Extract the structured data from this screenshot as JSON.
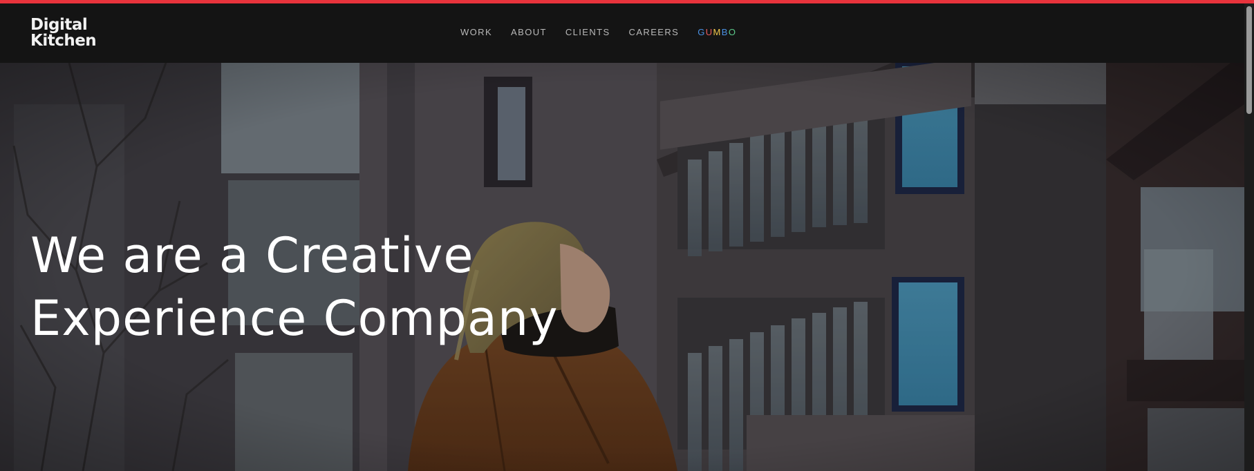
{
  "brand": {
    "logo_line1": "Digital",
    "logo_line2": "Kitchen",
    "accent_color": "#e8333c"
  },
  "nav": {
    "items": [
      {
        "label": "WORK"
      },
      {
        "label": "ABOUT"
      },
      {
        "label": "CLIENTS"
      },
      {
        "label": "CAREERS"
      }
    ],
    "gumbo": {
      "letters": [
        {
          "char": "G",
          "color": "#4a90e2"
        },
        {
          "char": "U",
          "color": "#e85a5a"
        },
        {
          "char": "M",
          "color": "#f2c94c"
        },
        {
          "char": "B",
          "color": "#4a90e2"
        },
        {
          "char": "O",
          "color": "#5cc98a"
        }
      ]
    }
  },
  "hero": {
    "title_line1": "We are a Creative",
    "title_line2": "Experience Company",
    "background_icon": "hero-video-still"
  }
}
